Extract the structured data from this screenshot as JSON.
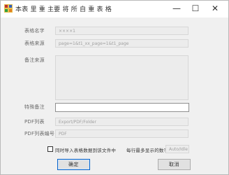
{
  "window": {
    "title": "本表 里 重 主要 将 所 自 重 表 格",
    "icon": "app-grid-icon",
    "minimize": "—",
    "maximize": "☐",
    "close": "✕"
  },
  "form": {
    "name_label": "表格名字",
    "name_value": "××××1",
    "source_label": "表格来源",
    "source_value": "page=1&t1_xx_page=1&t1_page",
    "desc_label": "备注来源",
    "desc_value": "",
    "extra_label": "特殊备注",
    "extra_value": "",
    "pdf_label": "PDF列表",
    "pdf_value": "Export/PDF/Folder",
    "pdf_id_label": "PDF列表编号",
    "pdf_id_value": "PDF",
    "checkbox_label": "同时导入表格数据到该文件中",
    "checkbox_checked": false,
    "count_label": "每行最多显示的数字",
    "count_value": "Auto/Idle"
  },
  "buttons": {
    "ok": "确定",
    "cancel": "取消"
  }
}
